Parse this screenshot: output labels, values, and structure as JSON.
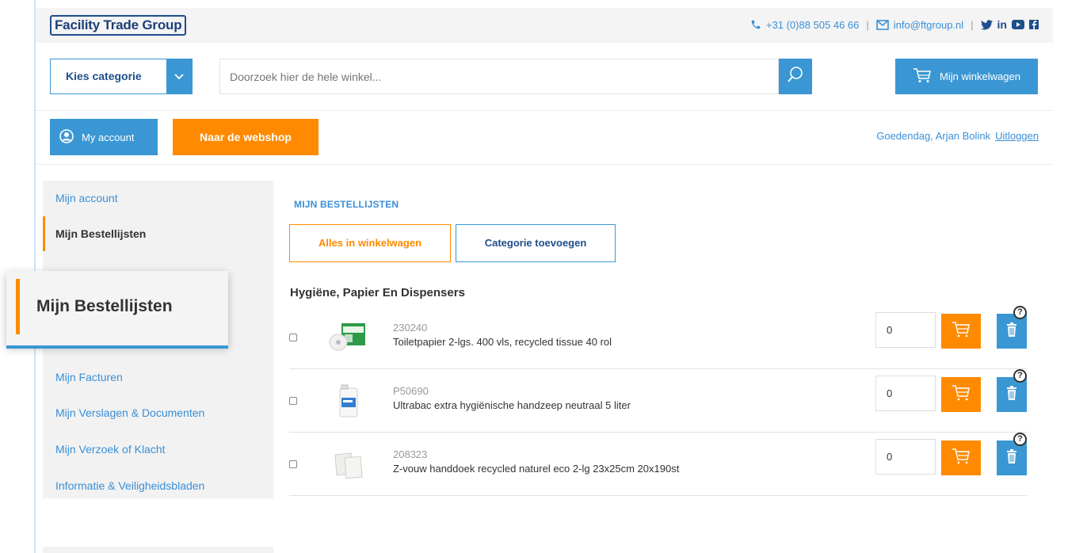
{
  "header": {
    "logo": "Facility Trade Group",
    "phone": "+31 (0)88 505 46 66",
    "separator": "|",
    "email": "info@ftgroup.nl",
    "social_icons": [
      "twitter-icon",
      "linkedin-icon",
      "youtube-icon",
      "facebook-icon"
    ],
    "social_text": {
      "linkedin": "in"
    }
  },
  "search_bar": {
    "category_label": "Kies categorie",
    "placeholder": "Doorzoek hier de hele winkel...",
    "cart_label": "Mijn winkelwagen"
  },
  "account_bar": {
    "my_account_label": "My account",
    "webshop_label": "Naar de webshop",
    "greeting": "Goedendag, Arjan Bolink",
    "logout_label": "Uitloggen"
  },
  "sidebar": {
    "items": [
      {
        "label": "Mijn account",
        "active": false
      },
      {
        "label": "Mijn Bestellijsten",
        "active": true
      },
      {
        "label": "Mijn Facturen",
        "active": false
      },
      {
        "label": "Mijn Verslagen & Documenten",
        "active": false
      },
      {
        "label": "Mijn Verzoek of Klacht",
        "active": false
      },
      {
        "label": "Informatie & Veiligheidsbladen",
        "active": false
      }
    ],
    "zoom_label": "Mijn Bestellijsten"
  },
  "main": {
    "title": "MIJN BESTELLIJSTEN",
    "all_to_cart_label": "Alles in winkelwagen",
    "add_category_label": "Categorie toevoegen",
    "group_title": "Hygiëne, Papier En Dispensers",
    "products": [
      {
        "sku": "230240",
        "name": "Toiletpapier 2-lgs. 400 vls, recycled tissue 40 rol",
        "qty": "0",
        "help": "?"
      },
      {
        "sku": "P50690",
        "name": "Ultrabac extra hygiënische handzeep neutraal 5 liter",
        "qty": "0",
        "help": "?"
      },
      {
        "sku": "208323",
        "name": "Z-vouw handdoek recycled naturel eco 2-lg 23x25cm 20x190st",
        "qty": "0",
        "help": "?"
      }
    ]
  },
  "colors": {
    "accent_blue": "#3a97d4",
    "accent_orange": "#ff8a00",
    "brand_navy": "#1e4e8c"
  }
}
